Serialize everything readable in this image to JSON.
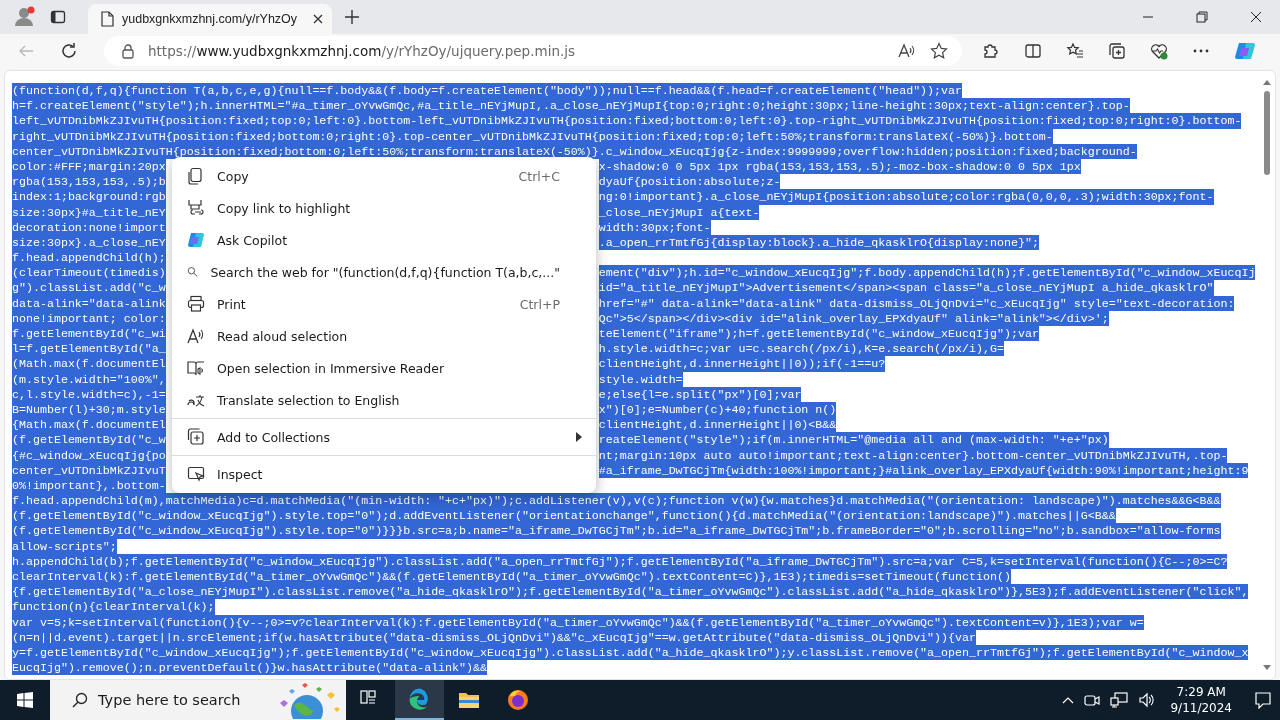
{
  "browser": {
    "tab": {
      "title": "yudbxgnkxmzhnj.com/y/rYhzOy"
    },
    "address": {
      "scheme": "https://",
      "host": "www.yudbxgnkxmzhnj.com",
      "path": "/y/rYhzOy/ujquery.pep.min.js"
    }
  },
  "code_lines": [
    {
      "text": "(function(d,f,q){function T(a,b,c,e,g){null==f.body&&(f.body=f.createElement(\"body\"));null==f.head&&(f.head=f.createElement(\"head\"));var"
    },
    {
      "text": "h=f.createElement(\"style\");h.innerHTML=\"#a_timer_oYvwGmQc,#a_title_nEYjMupI,.a_close_nEYjMupI{top:0;right:0;height:30px;line-height:30px;text-align:center}.top-"
    },
    {
      "text": "left_vUTDnibMkZJIvuTH{position:fixed;top:0;left:0}.bottom-left_vUTDnibMkZJIvuTH{position:fixed;bottom:0;left:0}.top-right_vUTDnibMkZJIvuTH{position:fixed;top:0;right:0}.bottom-"
    },
    {
      "text": "right_vUTDnibMkZJIvuTH{position:fixed;bottom:0;right:0}.top-center_vUTDnibMkZJIvuTH{position:fixed;top:0;left:50%;transform:translateX(-50%)}.bottom-"
    },
    {
      "text": "center_vUTDnibMkZJIvuTH{position:fixed;bottom:0;left:50%;transform:translateX(-50%)}.c_window_xEucqIjg{z-index:9999999;overflow:hidden;position:fixed;background-"
    },
    {
      "left": "color:#FFF;margin:20px",
      "right": "x-shadow:0 0 5px 1px rgba(153,153,153,.5);-moz-box-shadow:0 0 5px 1px"
    },
    {
      "left": "rgba(153,153,153,.5);b",
      "right": "dyaUf{position:absolute;z-"
    },
    {
      "left": "index:1;background:rgb",
      "right": "ng:0!important}.a_close_nEYjMupI{position:absolute;color:rgba(0,0,0,.3);width:30px;font-"
    },
    {
      "left": "size:30px}#a_title_nEY",
      "right": "_close_nEYjMupI a{text-"
    },
    {
      "left": "decoration:none!import",
      "right": "width:30px;font-"
    },
    {
      "left": "size:30px}.a_close_nEY",
      "right": ".a_open_rrTmtfGj{display:block}.a_hide_qkasklrO{display:none}\";"
    },
    {
      "left": "f.head.appendChild(h);"
    },
    {
      "left": "(clearTimeout(timedis)",
      "right": "ement(\"div\");h.id=\"c_window_xEucqIjg\";f.body.appendChild(h);f.getElementById(\"c_window_xEucqIj"
    },
    {
      "left": "g\").classList.add(\"c_w",
      "right": "id=\"a_title_nEYjMupI\">Advertisement</span><span class=\"a_close_nEYjMupI a_hide_qkasklrO\""
    },
    {
      "left": "data-alink=\"data-alink",
      "right": "href=\"#\" data-alink=\"data-alink\" data-dismiss_OLjQnDvi=\"c_xEucqIjg\" style=\"text-decoration:"
    },
    {
      "left": "none!important; color:",
      "right": "Qc\">5</span></div><div id=\"alink_overlay_EPXdyaUf\" alink=\"alink\"></div>';"
    },
    {
      "left": "f.getElementById(\"c_wi",
      "right": "teElement(\"iframe\");h=f.getElementById(\"c_window_xEucqIjg\");var"
    },
    {
      "left": "l=f.getElementById(\"a_",
      "right": "h.style.width=c;var u=c.search(/px/i),K=e.search(/px/i),G="
    },
    {
      "left": "(Math.max(f.documentEl",
      "right": "clientHeight,d.innerHeight||0));if(-1==u?"
    },
    {
      "left": "(m.style.width=\"100%\",",
      "right": "style.width="
    },
    {
      "left": "c,l.style.width=c),-1=",
      "right": "e;else{l=e.split(\"px\")[0];var"
    },
    {
      "left": "B=Number(l)+30;m.style",
      "right": "x\")[0];e=Number(c)+40;function n()"
    },
    {
      "left": "{Math.max(f.documentEl",
      "right": "clientHeight,d.innerHeight||0)<B&&"
    },
    {
      "left": "(f.getElementById(\"c_w",
      "right": "reateElement(\"style\");if(m.innerHTML=\"@media all and (max-width: \"+e+\"px)"
    },
    {
      "left": "{#c_window_xEucqIjg{po",
      "right": "nt;margin:10px auto auto!important;text-align:center}.bottom-center_vUTDnibMkZJIvuTH,.top-"
    },
    {
      "left": "center_vUTDnibMkZJIvuT",
      "right": "#a_iframe_DwTGCjTm{width:100%!important;}#alink_overlay_EPXdyaUf{width:90%!important;height:9"
    },
    {
      "left": "0%!important},.bottom-"
    },
    {
      "text": "f.head.appendChild(m),matchMedia)c=d.matchMedia(\"(min-width: \"+c+\"px)\");c.addListener(v),v(c);function v(w){w.matches}d.matchMedia(\"(orientation: landscape)\").matches&&G<B&&"
    },
    {
      "text": "(f.getElementById(\"c_window_xEucqIjg\").style.top=\"0\");d.addEventListener(\"orientationchange\",function(){d.matchMedia(\"(orientation:landscape)\").matches||G<B&&"
    },
    {
      "text": "(f.getElementById(\"c_window_xEucqIjg\").style.top=\"0\")}}}b.src=a;b.name=\"a_iframe_DwTGCjTm\";b.id=\"a_iframe_DwTGCjTm\";b.frameBorder=\"0\";b.scrolling=\"no\";b.sandbox=\"allow-forms"
    },
    {
      "text": "allow-scripts\";"
    },
    {
      "text": "h.appendChild(b);f.getElementById(\"c_window_xEucqIjg\").classList.add(\"a_open_rrTmtfGj\");f.getElementById(\"a_iframe_DwTGCjTm\").src=a;var C=5,k=setInterval(function(){C--;0>=C?"
    },
    {
      "text": "clearInterval(k):f.getElementById(\"a_timer_oYvwGmQc\")&&(f.getElementById(\"a_timer_oYvwGmQc\").textContent=C)},1E3);timedis=setTimeout(function()"
    },
    {
      "text": "{f.getElementById(\"a_close_nEYjMupI\").classList.remove(\"a_hide_qkasklrO\");f.getElementById(\"a_timer_oYvwGmQc\").classList.add(\"a_hide_qkasklrO\")},5E3);f.addEventListener(\"click\","
    },
    {
      "text": "function(n){clearInterval(k);"
    },
    {
      "text": "var v=5;k=setInterval(function(){v--;0>=v?clearInterval(k):f.getElementById(\"a_timer_oYvwGmQc\")&&(f.getElementById(\"a_timer_oYvwGmQc\").textContent=v)},1E3);var w="
    },
    {
      "text": "(n=n||d.event).target||n.srcElement;if(w.hasAttribute(\"data-dismiss_OLjQnDvi\")&&\"c_xEucqIjg\"==w.getAttribute(\"data-dismiss_OLjQnDvi\")){var"
    },
    {
      "text": "y=f.getElementById(\"c_window_xEucqIjg\");f.getElementById(\"c_window_xEucqIjg\").classList.add(\"a_hide_qkasklrO\");y.classList.remove(\"a_open_rrTmtfGj\");f.getElementById(\"c_window_x"
    },
    {
      "text": "EucqIjg\").remove();n.preventDefault()}w.hasAttribute(\"data-alink\")&&"
    }
  ],
  "context_menu": {
    "items": [
      {
        "kind": "item",
        "label": "Copy",
        "shortcut": "Ctrl+C"
      },
      {
        "kind": "item",
        "label": "Copy link to highlight"
      },
      {
        "kind": "item",
        "label": "Ask Copilot"
      },
      {
        "kind": "item",
        "label": "Search the web for \"(function(d,f,q){function T(a,b,c,...\""
      },
      {
        "kind": "item",
        "label": "Print",
        "shortcut": "Ctrl+P"
      },
      {
        "kind": "item",
        "label": "Read aloud selection"
      },
      {
        "kind": "item",
        "label": "Open selection in Immersive Reader"
      },
      {
        "kind": "item",
        "label": "Translate selection to English"
      },
      {
        "kind": "separator"
      },
      {
        "kind": "item",
        "label": "Add to Collections",
        "submenu": true
      },
      {
        "kind": "separator"
      },
      {
        "kind": "item",
        "label": "Inspect"
      }
    ]
  },
  "taskbar": {
    "search": {
      "placeholder": "Type here to search"
    },
    "clock": {
      "time": "7:29 AM",
      "date": "9/11/2024"
    }
  }
}
